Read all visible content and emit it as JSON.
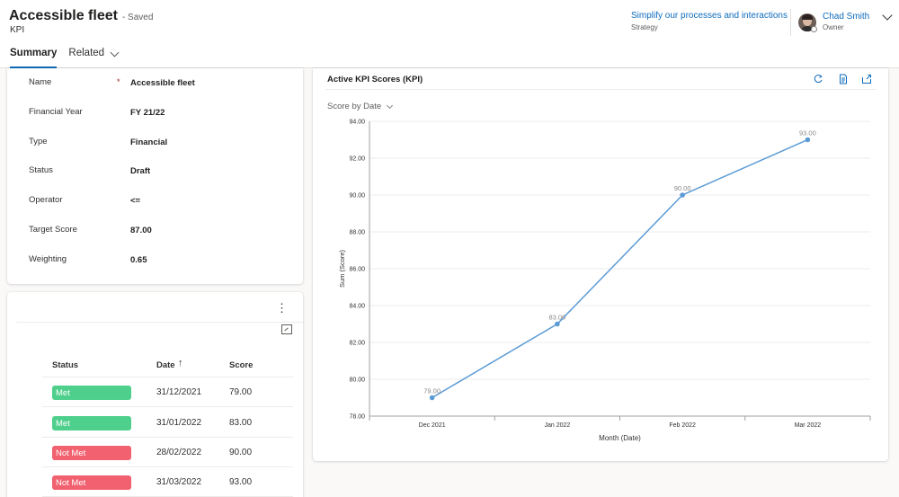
{
  "header": {
    "title": "Accessible fleet",
    "saved": "- Saved",
    "entity": "KPI",
    "bpf_title": "Simplify our processes and interactions",
    "bpf_stage": "Strategy",
    "owner_name": "Chad Smith",
    "owner_role": "Owner"
  },
  "tabs": [
    {
      "label": "Summary",
      "active": true
    },
    {
      "label": "Related",
      "active": false
    }
  ],
  "fields": [
    {
      "label": "Name",
      "value": "Accessible fleet",
      "required_mark": "*"
    },
    {
      "label": "Financial Year",
      "value": "FY 21/22"
    },
    {
      "label": "Type",
      "value": "Financial"
    },
    {
      "label": "Status",
      "value": "Draft"
    },
    {
      "label": "Operator",
      "value": "<="
    },
    {
      "label": "Target Score",
      "value": "87.00"
    },
    {
      "label": "Weighting",
      "value": "0.65"
    }
  ],
  "grid": {
    "more_glyph": "⋮",
    "sort_glyph": "↑",
    "columns": [
      "Status",
      "Date",
      "Score"
    ],
    "rows": [
      {
        "status": "Met",
        "date": "31/12/2021",
        "score": "79.00"
      },
      {
        "status": "Met",
        "date": "31/01/2022",
        "score": "83.00"
      },
      {
        "status": "Not Met",
        "date": "28/02/2022",
        "score": "90.00"
      },
      {
        "status": "Not Met",
        "date": "31/03/2022",
        "score": "93.00"
      }
    ]
  },
  "colors": {
    "met": "#4fcf8c",
    "not_met": "#f1616f",
    "accent": "#0f6cbd",
    "series": "#5b9bd5"
  },
  "chart": {
    "card_title": "Active KPI Scores (KPI)",
    "view_label": "Score by Date",
    "icons": [
      "refresh-icon",
      "records-icon",
      "expand-chart-icon"
    ]
  },
  "chart_data": {
    "type": "line",
    "categories": [
      "Dec 2021",
      "Jan 2022",
      "Feb 2022",
      "Mar 2022"
    ],
    "values": [
      79.0,
      83.0,
      90.0,
      93.0
    ],
    "data_labels": [
      "79.00",
      "83.00",
      "90.00",
      "93.00"
    ],
    "title": "",
    "xlabel": "Month (Date)",
    "ylabel": "Sum (Score)",
    "ylim": [
      78,
      94
    ],
    "yticks": [
      "78.00",
      "80.00",
      "82.00",
      "84.00",
      "86.00",
      "88.00",
      "90.00",
      "92.00",
      "94.00"
    ],
    "grid": true,
    "legend": "none"
  }
}
